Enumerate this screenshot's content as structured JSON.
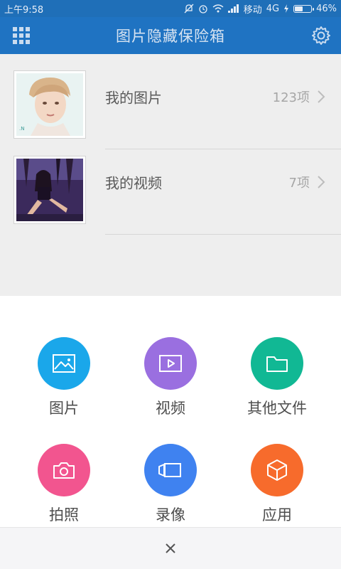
{
  "status_bar": {
    "time": "上午9:58",
    "carrier": "移动",
    "network": "4G",
    "battery_percent": "46%",
    "battery_level": 0.46
  },
  "app_bar": {
    "title": "图片隐藏保险箱",
    "left_icon": "grid-menu-icon",
    "right_icon": "gear-icon",
    "color": "#1f73c2"
  },
  "list": {
    "items": [
      {
        "label": "我的图片",
        "count": "123项",
        "thumbnail": "portrait-photo"
      },
      {
        "label": "我的视频",
        "count": "7项",
        "thumbnail": "dance-video-frame"
      }
    ]
  },
  "sheet": {
    "actions": [
      {
        "label": "图片",
        "icon": "image-icon",
        "color": "#1aa7ea"
      },
      {
        "label": "视频",
        "icon": "video-icon",
        "color": "#9a6fe0"
      },
      {
        "label": "其他文件",
        "icon": "folder-icon",
        "color": "#11b894"
      },
      {
        "label": "拍照",
        "icon": "camera-icon",
        "color": "#f2558f"
      },
      {
        "label": "录像",
        "icon": "video-camera-icon",
        "color": "#3f82f0"
      },
      {
        "label": "应用",
        "icon": "cube-icon",
        "color": "#f76b2c"
      }
    ],
    "close_icon": "close-icon"
  }
}
